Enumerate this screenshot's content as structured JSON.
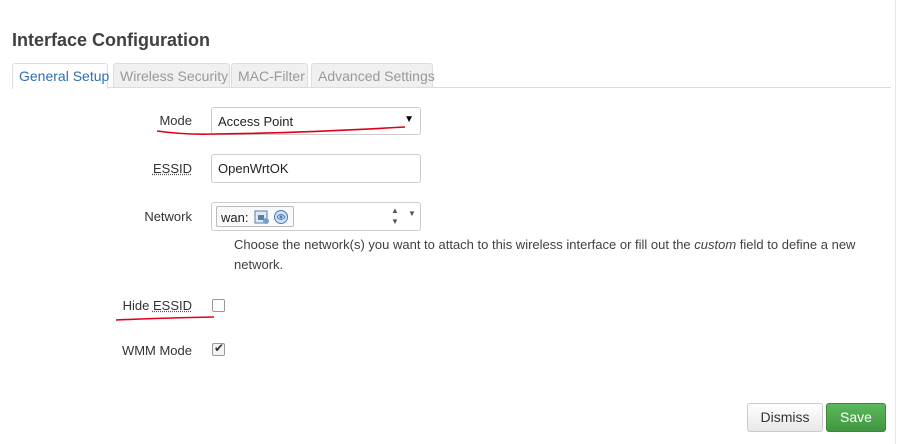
{
  "page": {
    "title": "Interface Configuration"
  },
  "tabs": [
    {
      "label": "General Setup",
      "active": true
    },
    {
      "label": "Wireless Security",
      "active": false
    },
    {
      "label": "MAC-Filter",
      "active": false
    },
    {
      "label": "Advanced Settings",
      "active": false
    }
  ],
  "form": {
    "mode": {
      "label": "Mode",
      "value": "Access Point"
    },
    "essid": {
      "label": "ESSID",
      "value": "OpenWrtOK"
    },
    "network": {
      "label": "Network",
      "chip": "wan:",
      "chip_icons": [
        "ethernet-port-icon",
        "wireless-globe-icon"
      ],
      "help_before": "Choose the network(s) you want to attach to this wireless interface or fill out the ",
      "help_em": "custom",
      "help_after": " field to define a new network."
    },
    "hide_essid": {
      "label_prefix": "Hide ",
      "label_abbr": "ESSID",
      "checked": false
    },
    "wmm_mode": {
      "label": "WMM Mode",
      "checked": true
    }
  },
  "buttons": {
    "dismiss": "Dismiss",
    "save": "Save"
  },
  "colors": {
    "tab_active_text": "#2f6fb5",
    "save_button": "#4fa84f",
    "annotation_ink": "#e0001a"
  }
}
